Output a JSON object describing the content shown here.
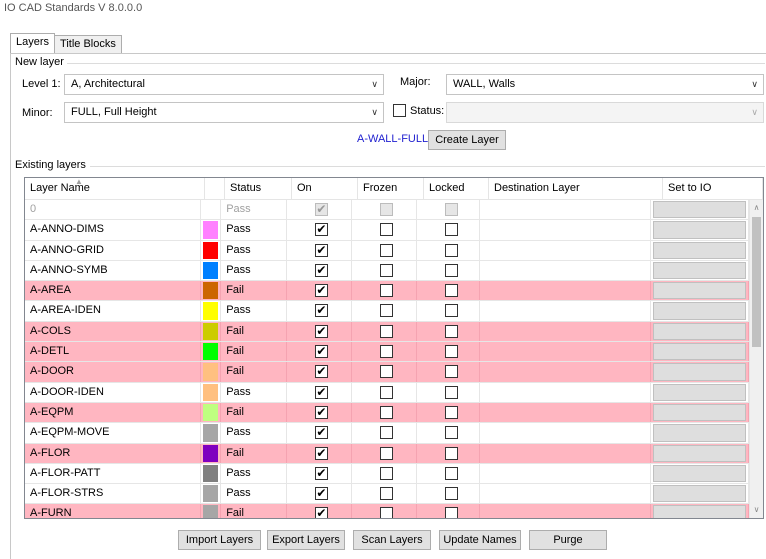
{
  "window": {
    "title": "IO CAD Standards V 8.0.0.0"
  },
  "tabs": [
    {
      "label": "Layers",
      "active": true
    },
    {
      "label": "Title Blocks",
      "active": false
    }
  ],
  "new_layer": {
    "group_label": "New layer",
    "level1_label": "Level 1:",
    "level1_value": "A, Architectural",
    "major_label": "Major:",
    "major_value": "WALL, Walls",
    "minor_label": "Minor:",
    "minor_value": "FULL, Full Height",
    "status_label": "Status:",
    "status_checked": false,
    "status_value": "",
    "generated_name": "A-WALL-FULL",
    "create_button": "Create Layer"
  },
  "existing_layers": {
    "group_label": "Existing layers",
    "columns": [
      "Layer Name",
      "",
      "Status",
      "On",
      "Frozen",
      "Locked",
      "Destination Layer",
      "Set to IO"
    ],
    "rows": [
      {
        "name": "0",
        "color": "",
        "status": "Pass",
        "on": true,
        "frozen": false,
        "locked": false,
        "destination": "",
        "disabled": true
      },
      {
        "name": "A-ANNO-DIMS",
        "color": "#ff80ff",
        "status": "Pass",
        "on": true,
        "frozen": false,
        "locked": false,
        "destination": ""
      },
      {
        "name": "A-ANNO-GRID",
        "color": "#ff0000",
        "status": "Pass",
        "on": true,
        "frozen": false,
        "locked": false,
        "destination": ""
      },
      {
        "name": "A-ANNO-SYMB",
        "color": "#0080ff",
        "status": "Pass",
        "on": true,
        "frozen": false,
        "locked": false,
        "destination": ""
      },
      {
        "name": "A-AREA",
        "color": "#cc6600",
        "status": "Fail",
        "on": true,
        "frozen": false,
        "locked": false,
        "destination": ""
      },
      {
        "name": "A-AREA-IDEN",
        "color": "#ffff00",
        "status": "Pass",
        "on": true,
        "frozen": false,
        "locked": false,
        "destination": ""
      },
      {
        "name": "A-COLS",
        "color": "#cccc00",
        "status": "Fail",
        "on": true,
        "frozen": false,
        "locked": false,
        "destination": ""
      },
      {
        "name": "A-DETL",
        "color": "#00ff00",
        "status": "Fail",
        "on": true,
        "frozen": false,
        "locked": false,
        "destination": ""
      },
      {
        "name": "A-DOOR",
        "color": "#ffc080",
        "status": "Fail",
        "on": true,
        "frozen": false,
        "locked": false,
        "destination": ""
      },
      {
        "name": "A-DOOR-IDEN",
        "color": "#ffc080",
        "status": "Pass",
        "on": true,
        "frozen": false,
        "locked": false,
        "destination": ""
      },
      {
        "name": "A-EQPM",
        "color": "#bfff80",
        "status": "Fail",
        "on": true,
        "frozen": false,
        "locked": false,
        "destination": ""
      },
      {
        "name": "A-EQPM-MOVE",
        "color": "#a6a6a6",
        "status": "Pass",
        "on": true,
        "frozen": false,
        "locked": false,
        "destination": ""
      },
      {
        "name": "A-FLOR",
        "color": "#7f00bf",
        "status": "Fail",
        "on": true,
        "frozen": false,
        "locked": false,
        "destination": ""
      },
      {
        "name": "A-FLOR-PATT",
        "color": "#808080",
        "status": "Pass",
        "on": true,
        "frozen": false,
        "locked": false,
        "destination": ""
      },
      {
        "name": "A-FLOR-STRS",
        "color": "#a6a6a6",
        "status": "Pass",
        "on": true,
        "frozen": false,
        "locked": false,
        "destination": ""
      },
      {
        "name": "A-FURN",
        "color": "#a6a6a6",
        "status": "Fail",
        "on": true,
        "frozen": false,
        "locked": false,
        "destination": ""
      }
    ]
  },
  "footer_buttons": [
    "Import Layers",
    "Export Layers",
    "Scan Layers",
    "Update Names",
    "Purge"
  ]
}
